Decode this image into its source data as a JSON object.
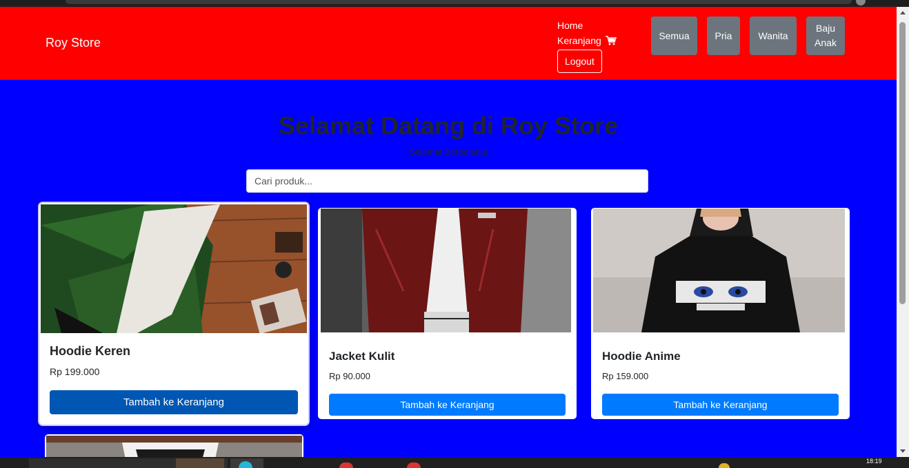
{
  "navbar": {
    "brand": "Roy Store",
    "links": {
      "home": "Home",
      "cart": "Keranjang",
      "logout": "Logout"
    },
    "categories": [
      {
        "label": "Semua"
      },
      {
        "label": "Pria"
      },
      {
        "label": "Wanita"
      },
      {
        "label": "Baju Anak"
      }
    ],
    "bg_color": "#ff0000"
  },
  "hero": {
    "title": "Selamat Datang di Roy Store",
    "subtitle": "Selamat Berbelanja"
  },
  "search": {
    "placeholder": "Cari produk..."
  },
  "products": [
    {
      "name": "Hoodie Keren",
      "price": "Rp 199.000",
      "button": "Tambah ke Keranjang",
      "image": "green-bomber-jacket-photo"
    },
    {
      "name": "Jacket Kulit",
      "price": "Rp 90.000",
      "button": "Tambah ke Keranjang",
      "image": "maroon-leather-jacket-photo"
    },
    {
      "name": "Hoodie Anime",
      "price": "Rp 159.000",
      "button": "Tambah ke Keranjang",
      "image": "black-anime-hoodie-photo"
    }
  ],
  "colors": {
    "page_bg": "#0000ff",
    "navbar_bg": "#ff0000",
    "category_button": "#6c757d",
    "primary_button": "#007bff",
    "primary_button_hover": "#0056b3"
  },
  "taskbar": {
    "clock": "18:19"
  }
}
